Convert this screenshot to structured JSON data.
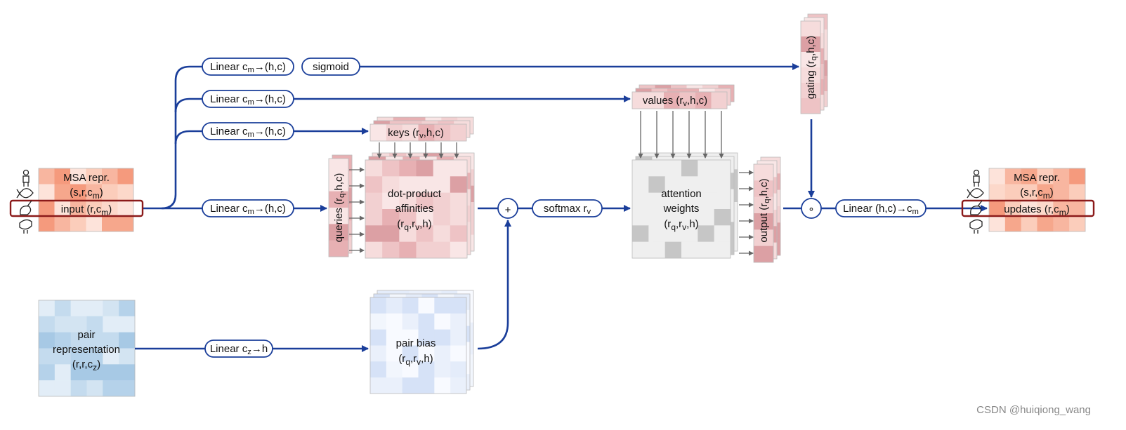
{
  "colors": {
    "flow": "#1a3e9a",
    "highlight_box": "#8b1a1a",
    "msa_palette": [
      "#fde3da",
      "#fbcdbb",
      "#f8b6a0",
      "#f59a7d",
      "#fcd8ca",
      "#f6a78c"
    ],
    "attn_palette": [
      "#f6dcdc",
      "#eec3c5",
      "#e7b0b3",
      "#f2d0d1",
      "#dca0a4",
      "#f9e6e6"
    ],
    "pair_palette": [
      "#d3e4f2",
      "#b5d2ea",
      "#c4dbee",
      "#e2edf7",
      "#a7c9e5"
    ],
    "bias_palette": [
      "#f2f6fd",
      "#e4ecfa",
      "#d6e2f7",
      "#eaf0fb",
      "#f8faff"
    ],
    "weights_palette": [
      "#efefef",
      "#c6c6c6"
    ]
  },
  "msa_input": {
    "line1": [
      {
        "t": "MSA repr."
      }
    ],
    "line2": [
      {
        "t": "(s,r,c"
      },
      {
        "t": "m",
        "sub": true
      },
      {
        "t": ")"
      }
    ],
    "row": [
      {
        "t": "input (r,c"
      },
      {
        "t": "m",
        "sub": true
      },
      {
        "t": ")"
      }
    ]
  },
  "msa_output": {
    "line1": [
      {
        "t": "MSA repr."
      }
    ],
    "line2": [
      {
        "t": "(s,r,c"
      },
      {
        "t": "m",
        "sub": true
      },
      {
        "t": ")"
      }
    ],
    "row": [
      {
        "t": "updates (r,c"
      },
      {
        "t": "m",
        "sub": true
      },
      {
        "t": ")"
      }
    ]
  },
  "species_icons": [
    "human-icon",
    "fish-icon",
    "rabbit-icon",
    "rooster-icon"
  ],
  "linear_gate": [
    {
      "t": "Linear c"
    },
    {
      "t": "m",
      "sub": true
    },
    {
      "t": "→(h,c)"
    }
  ],
  "sigmoid": [
    {
      "t": "sigmoid"
    }
  ],
  "linear_values": [
    {
      "t": "Linear c"
    },
    {
      "t": "m",
      "sub": true
    },
    {
      "t": "→(h,c)"
    }
  ],
  "linear_keys": [
    {
      "t": "Linear c"
    },
    {
      "t": "m",
      "sub": true
    },
    {
      "t": "→(h,c)"
    }
  ],
  "linear_queries": [
    {
      "t": "Linear c"
    },
    {
      "t": "m",
      "sub": true
    },
    {
      "t": "→(h,c)"
    }
  ],
  "gating": [
    {
      "t": "gating (r"
    },
    {
      "t": "q",
      "sub": true
    },
    {
      "t": ",h,c)"
    }
  ],
  "values": [
    {
      "t": "values (r"
    },
    {
      "t": "v",
      "sub": true
    },
    {
      "t": ",h,c)"
    }
  ],
  "keys": [
    {
      "t": "keys (r"
    },
    {
      "t": "v",
      "sub": true
    },
    {
      "t": ",h,c)"
    }
  ],
  "queries": [
    {
      "t": "queries (r"
    },
    {
      "t": "q",
      "sub": true
    },
    {
      "t": ",h,c)"
    }
  ],
  "affinities": {
    "line1": [
      {
        "t": "dot-product"
      }
    ],
    "line2": [
      {
        "t": "affinities"
      }
    ],
    "line3": [
      {
        "t": "(r"
      },
      {
        "t": "q",
        "sub": true
      },
      {
        "t": ",r"
      },
      {
        "t": "v",
        "sub": true
      },
      {
        "t": ",h)"
      }
    ]
  },
  "plus_symbol": [
    {
      "t": "+"
    }
  ],
  "softmax": [
    {
      "t": "softmax r"
    },
    {
      "t": "v",
      "sub": true
    }
  ],
  "attention_weights": {
    "line1": [
      {
        "t": "attention"
      }
    ],
    "line2": [
      {
        "t": "weights"
      }
    ],
    "line3": [
      {
        "t": "(r"
      },
      {
        "t": "q",
        "sub": true
      },
      {
        "t": ",r"
      },
      {
        "t": "v",
        "sub": true
      },
      {
        "t": ",h)"
      }
    ]
  },
  "output": [
    {
      "t": "output (r"
    },
    {
      "t": "q",
      "sub": true
    },
    {
      "t": ",h,c)"
    }
  ],
  "gate_product_symbol": [
    {
      "t": "∘"
    }
  ],
  "linear_out": [
    {
      "t": "Linear (h,c)→c"
    },
    {
      "t": "m",
      "sub": true
    }
  ],
  "pair_repr": {
    "line1": [
      {
        "t": "pair"
      }
    ],
    "line2": [
      {
        "t": "representation"
      }
    ],
    "line3": [
      {
        "t": "(r,r,c"
      },
      {
        "t": "z",
        "sub": true
      },
      {
        "t": ")"
      }
    ]
  },
  "linear_pair": [
    {
      "t": "Linear c"
    },
    {
      "t": "z",
      "sub": true
    },
    {
      "t": "→h"
    }
  ],
  "pair_bias": {
    "line1": [
      {
        "t": "pair bias"
      }
    ],
    "line2": [
      {
        "t": "(r"
      },
      {
        "t": "q",
        "sub": true
      },
      {
        "t": ",r"
      },
      {
        "t": "v",
        "sub": true
      },
      {
        "t": ",h)"
      }
    ]
  },
  "watermark": "CSDN @huiqiong_wang"
}
